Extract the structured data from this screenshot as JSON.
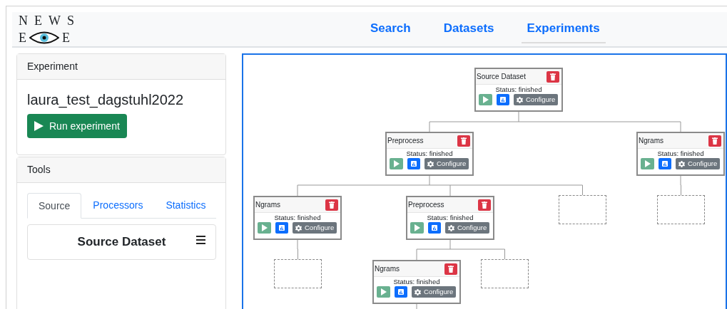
{
  "logo": {
    "line_1": "NEWS",
    "line_2_left": "E",
    "line_2_right": "E"
  },
  "nav": [
    {
      "label": "Search",
      "selected": false
    },
    {
      "label": "Datasets",
      "selected": false
    },
    {
      "label": "Experiments",
      "selected": true
    }
  ],
  "experiment": {
    "header": "Experiment",
    "name": "laura_test_dagstuhl2022",
    "run_button": "Run experiment"
  },
  "tools": {
    "header": "Tools",
    "tabs": [
      {
        "label": "Source",
        "selected": true
      },
      {
        "label": "Processors",
        "selected": false
      },
      {
        "label": "Statistics",
        "selected": false
      }
    ],
    "items": [
      {
        "label": "Source Dataset"
      }
    ]
  },
  "graph": {
    "kind": "node",
    "title": "Source Dataset",
    "status": "Status: finished",
    "configure": "Configure",
    "children": [
      {
        "kind": "node",
        "title": "Preprocess",
        "status": "Status: finished",
        "configure": "Configure",
        "children": [
          {
            "kind": "node",
            "title": "Ngrams",
            "status": "Status: finished",
            "configure": "Configure",
            "children": [
              {
                "kind": "placeholder"
              }
            ]
          },
          {
            "kind": "node",
            "title": "Preprocess",
            "status": "Status: finished",
            "configure": "Configure",
            "children": [
              {
                "kind": "node",
                "title": "Ngrams",
                "status": "Status: finished",
                "configure": "Configure",
                "children_below_view": true
              },
              {
                "kind": "placeholder"
              }
            ]
          },
          {
            "kind": "placeholder"
          }
        ]
      },
      {
        "kind": "node",
        "title": "Ngrams",
        "status": "Status: finished",
        "configure": "Configure",
        "children": [
          {
            "kind": "placeholder"
          }
        ]
      }
    ]
  }
}
